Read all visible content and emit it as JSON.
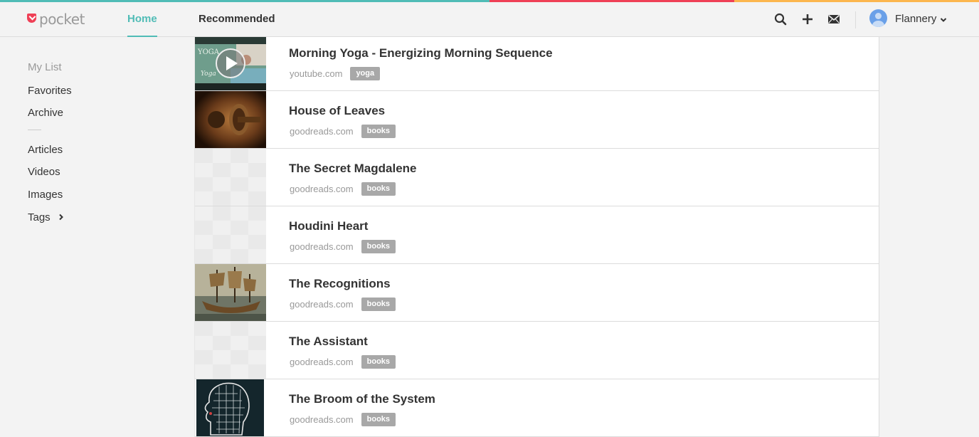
{
  "stripe_colors": [
    "#50bcb6",
    "#ef4056",
    "#fcb64e"
  ],
  "header": {
    "logo_text": "pocket",
    "tabs": [
      {
        "label": "Home",
        "active": true
      },
      {
        "label": "Recommended",
        "active": false
      }
    ],
    "icons": [
      "search-icon",
      "add-icon",
      "mail-icon"
    ],
    "user_name": "Flannery"
  },
  "sidebar": {
    "heading": "My List",
    "items": [
      "Favorites",
      "Archive",
      "Articles",
      "Videos",
      "Images",
      "Tags"
    ]
  },
  "items": [
    {
      "title": "Morning Yoga - Energizing Morning Sequence",
      "domain": "youtube.com",
      "tag": "yoga",
      "thumb": "video"
    },
    {
      "title": "House of Leaves",
      "domain": "goodreads.com",
      "tag": "books",
      "thumb": "door"
    },
    {
      "title": "The Secret Magdalene",
      "domain": "goodreads.com",
      "tag": "books",
      "thumb": "blank"
    },
    {
      "title": "Houdini Heart",
      "domain": "goodreads.com",
      "tag": "books",
      "thumb": "blank"
    },
    {
      "title": "The Recognitions",
      "domain": "goodreads.com",
      "tag": "books",
      "thumb": "ship"
    },
    {
      "title": "The Assistant",
      "domain": "goodreads.com",
      "tag": "books",
      "thumb": "blank"
    },
    {
      "title": "The Broom of the System",
      "domain": "goodreads.com",
      "tag": "books",
      "thumb": "map"
    }
  ]
}
